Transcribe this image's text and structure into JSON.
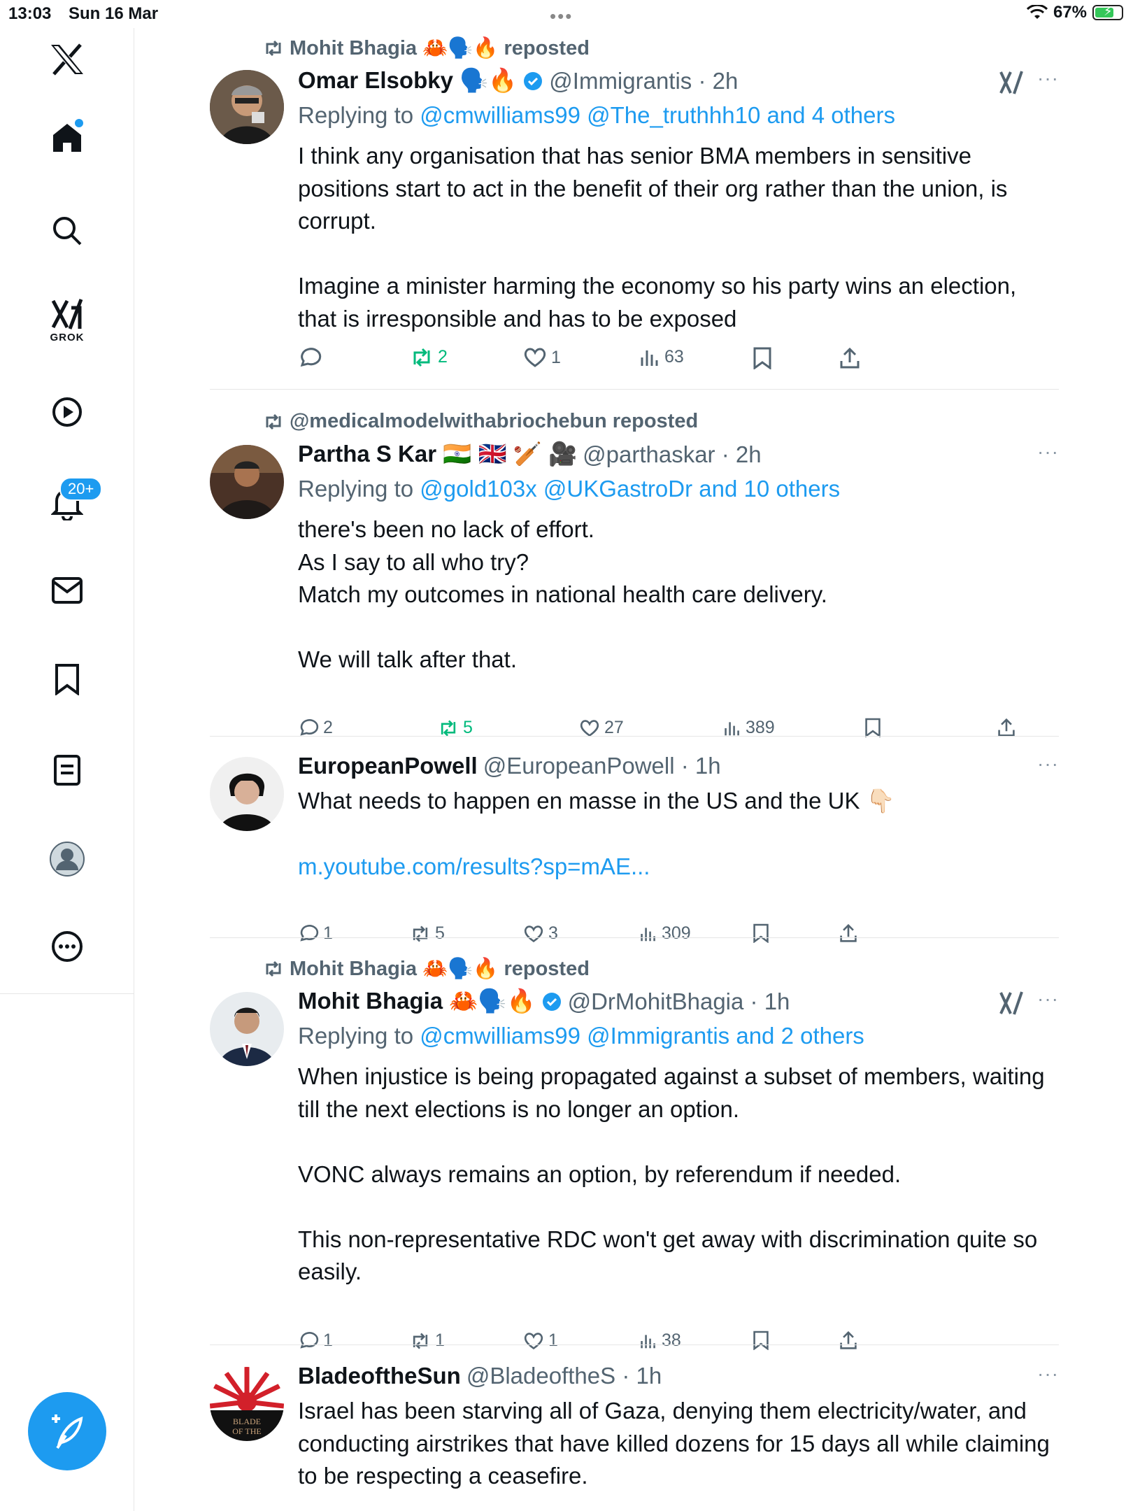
{
  "status_bar": {
    "time": "13:03",
    "date": "Sun 16 Mar",
    "battery": "67%"
  },
  "sidebar": {
    "grok_label": "GROK",
    "notifications_badge": "20+"
  },
  "posts": [
    {
      "repost_by": "Mohit Bhagia 🦀🗣️🔥",
      "repost_suffix": "reposted",
      "name": "Omar Elsobky 🗣️🔥",
      "handle": "@Immigrantis · 2h",
      "reply_prefix": "Replying to",
      "reply_to": "@cmwilliams99 @The_truthhh10 and 4 others",
      "text": "I think any organisation that has senior BMA members in sensitive positions start to act in the benefit of their org rather than the union, is corrupt.\n\nImagine a minister harming the economy so his party wins an election, that is irresponsible and has to be exposed",
      "replies": "",
      "reposts": "2",
      "likes": "1",
      "views": "63"
    },
    {
      "repost_by": "@medicalmodelwithabriochebun",
      "repost_suffix": "reposted",
      "name": "Partha S Kar 🇮🇳 🇬🇧 🏏 🎥",
      "handle": "@parthaskar · 2h",
      "reply_prefix": "Replying to",
      "reply_to": "@gold103x @UKGastroDr and 10 others",
      "text": "there's been no lack of effort.\nAs I say to all who try?\nMatch my outcomes in national health care delivery.\n\nWe will talk after that.",
      "replies": "2",
      "reposts": "5",
      "likes": "27",
      "views": "389"
    },
    {
      "name": "EuropeanPowell",
      "handle": "@EuropeanPowell · 1h",
      "text": "What needs to happen en masse in the US and the UK 👇🏻",
      "link": "m.youtube.com/results?sp=mAE...",
      "replies": "1",
      "reposts": "5",
      "likes": "3",
      "views": "309"
    },
    {
      "repost_by": "Mohit Bhagia 🦀🗣️🔥",
      "repost_suffix": "reposted",
      "name": "Mohit Bhagia 🦀🗣️🔥",
      "handle": "@DrMohitBhagia · 1h",
      "reply_prefix": "Replying to",
      "reply_to": "@cmwilliams99 @Immigrantis and 2 others",
      "text": "When injustice is being propagated against a subset of members, waiting till the next elections is no longer an option.\n\nVONC always remains an option, by referendum if needed.\n\nThis non-representative RDC won't get away with discrimination quite so easily.",
      "replies": "1",
      "reposts": "1",
      "likes": "1",
      "views": "38"
    },
    {
      "name": "BladeoftheSun",
      "handle": "@BladeoftheS · 1h",
      "text": "Israel has been starving all of Gaza, denying them electricity/water, and conducting airstrikes that have killed dozens for 15 days all while claiming to be respecting a ceasefire.",
      "avatar_text": "BLADE OF THE"
    }
  ],
  "more_label": "···",
  "colors": {
    "accent": "#1d9bf0",
    "repost_green": "#00ba7c",
    "muted": "#536471"
  }
}
